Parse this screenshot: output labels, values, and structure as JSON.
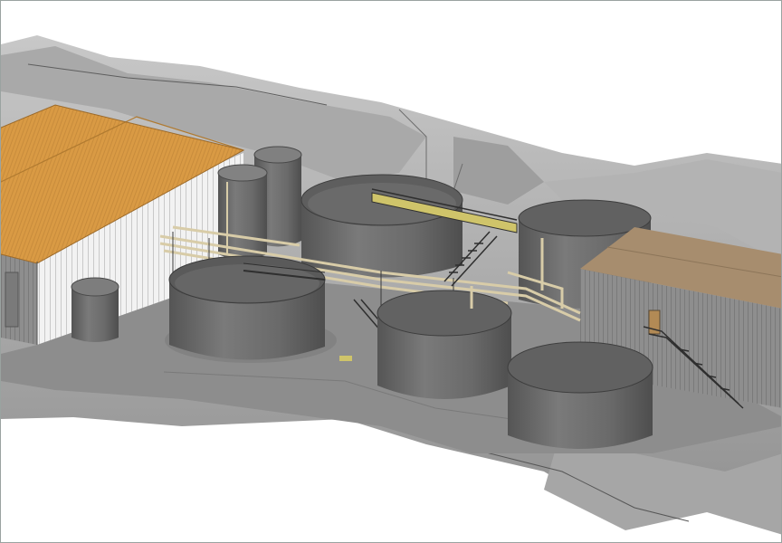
{
  "viewport": {
    "background": "#ffffff",
    "border_color": "#9aa3a0"
  },
  "model": {
    "colors": {
      "terrain_light": "#b9b9b9",
      "terrain_mid": "#9d9d9d",
      "terrain_dark": "#7f7f7f",
      "pad": "#8e8e8e",
      "tank_body": "#6d6d6d",
      "tank_interior": "#5a5a5a",
      "roof_orange": "#d89a45",
      "roof_tan": "#a78d6e",
      "wall_white": "#f0f0f0",
      "wall_grey": "#8c8c8c",
      "pipe": "#d8cca8",
      "railing": "#2f2f2f",
      "grating": "#cfc46a"
    },
    "objects": [
      "terrain",
      "concrete-pad",
      "process-building-orange-roof",
      "process-building-tan-roof",
      "clarifier-tank-left",
      "clarifier-tank-rear",
      "tank-center",
      "tank-front-right",
      "tank-rear-right",
      "silo-tall-left",
      "silo-tall-right",
      "small-tank",
      "pipe-rack",
      "stair-center",
      "stair-right-building"
    ]
  }
}
